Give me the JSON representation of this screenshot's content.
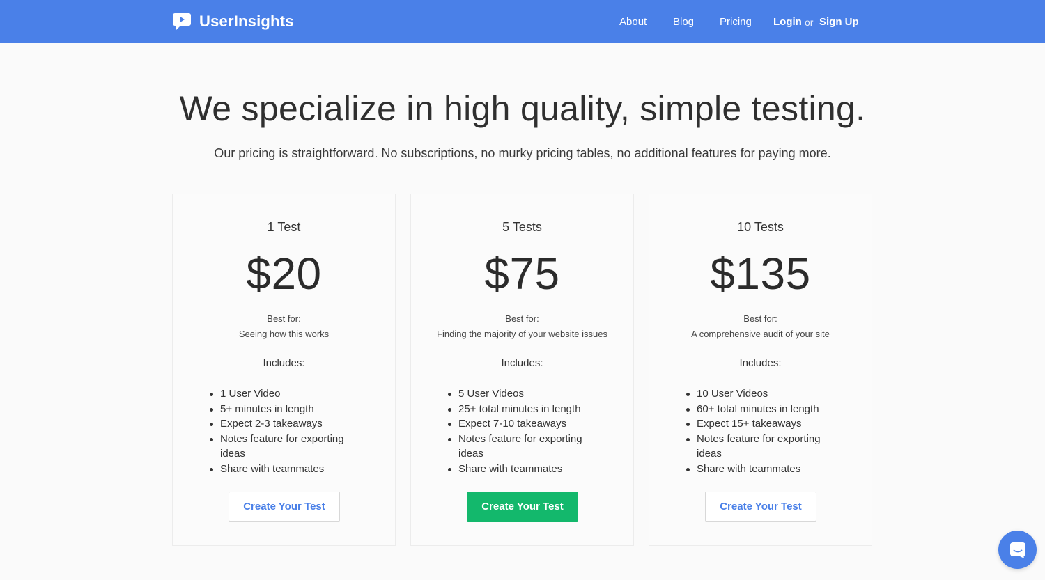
{
  "colors": {
    "navbar": "#4a80e8",
    "accent": "#4a80e8",
    "primary_button": "#13b86c",
    "background": "#fafafa"
  },
  "brand": {
    "name": "UserInsights",
    "icon": "speech-bubble-play-icon"
  },
  "nav": {
    "about": "About",
    "blog": "Blog",
    "pricing": "Pricing",
    "login": "Login",
    "or": "or",
    "signup": "Sign Up"
  },
  "hero": {
    "headline": "We specialize in high quality, simple testing.",
    "subhead": "Our pricing is straightforward. No subscriptions, no murky pricing tables, no additional features for paying more."
  },
  "plans": [
    {
      "title": "1 Test",
      "price": "$20",
      "best_for_label": "Best for:",
      "best_for": "Seeing how this works",
      "includes_label": "Includes:",
      "features": [
        "1 User Video",
        "5+ minutes in length",
        "Expect 2-3 takeaways",
        "Notes feature for exporting ideas",
        "Share with teammates"
      ],
      "cta": "Create Your Test"
    },
    {
      "title": "5 Tests",
      "price": "$75",
      "best_for_label": "Best for:",
      "best_for": "Finding the majority of your website issues",
      "includes_label": "Includes:",
      "features": [
        "5 User Videos",
        "25+ total minutes in length",
        "Expect 7-10 takeaways",
        "Notes feature for exporting ideas",
        "Share with teammates"
      ],
      "cta": "Create Your Test"
    },
    {
      "title": "10 Tests",
      "price": "$135",
      "best_for_label": "Best for:",
      "best_for": "A comprehensive audit of your site",
      "includes_label": "Includes:",
      "features": [
        "10 User Videos",
        "60+ total minutes in length",
        "Expect 15+ takeaways",
        "Notes feature for exporting ideas",
        "Share with teammates"
      ],
      "cta": "Create Your Test"
    }
  ],
  "chat": {
    "icon": "chat-bubble-icon"
  }
}
